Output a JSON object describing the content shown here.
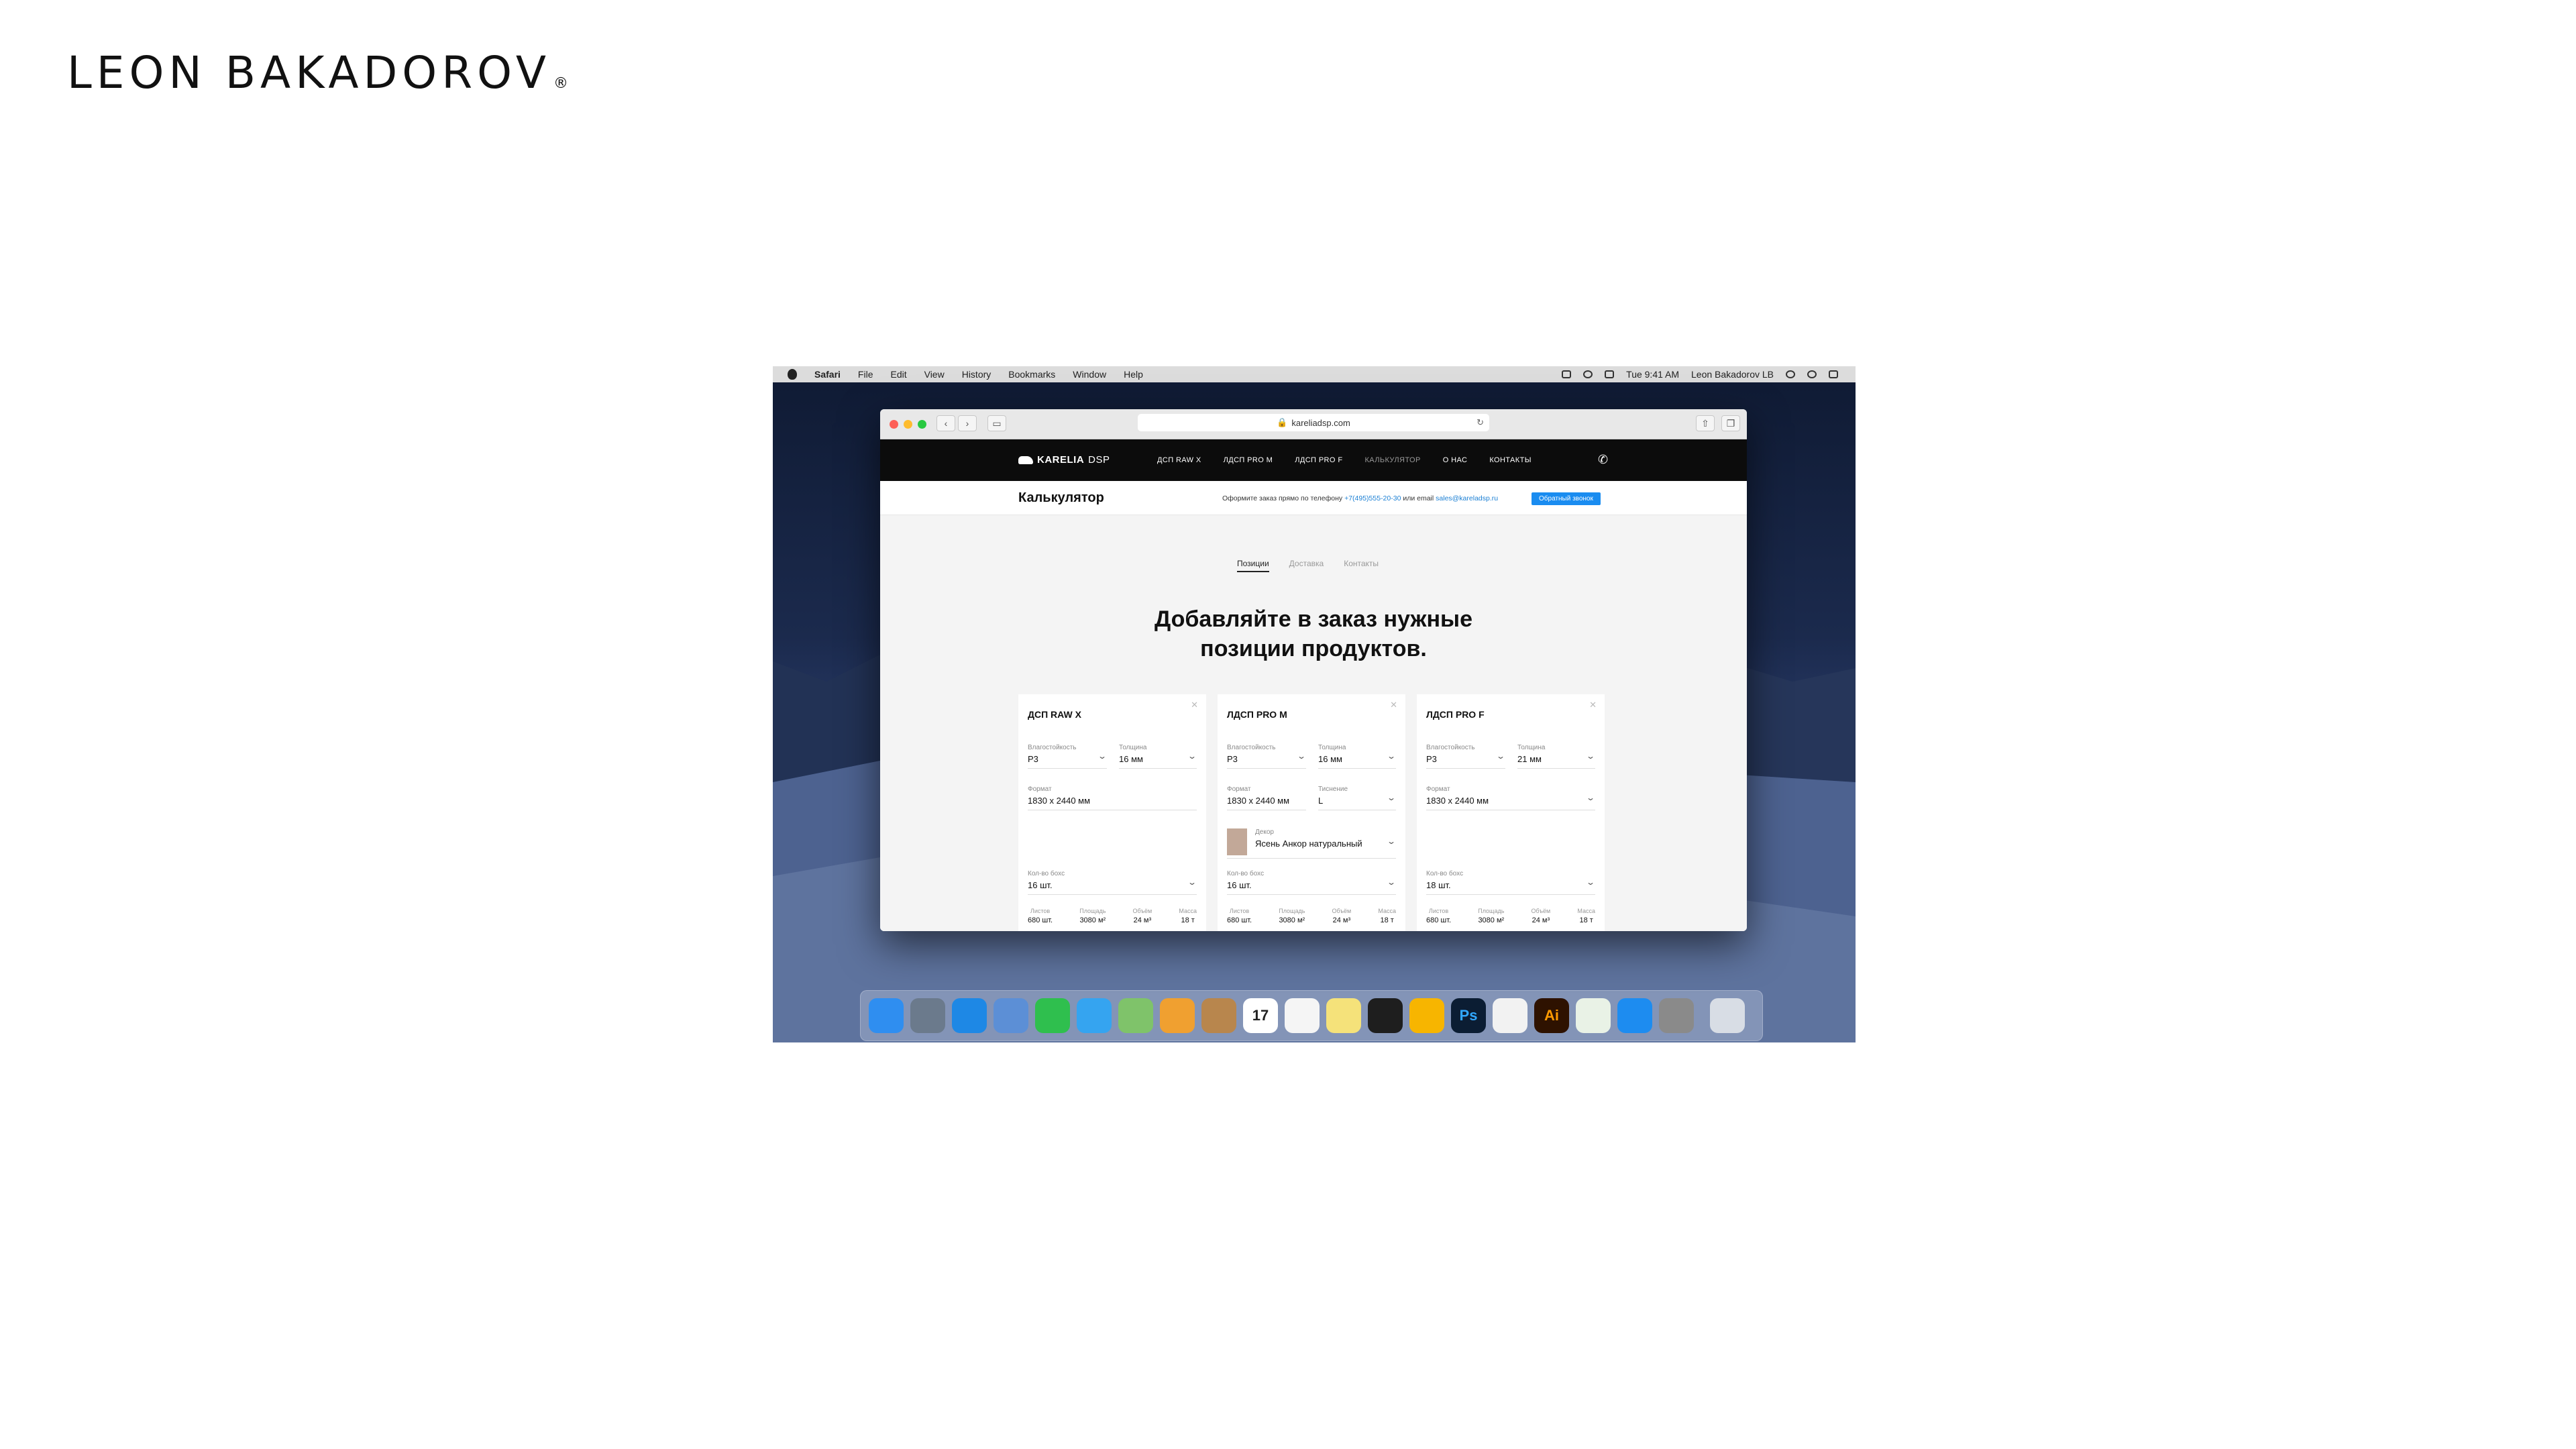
{
  "brand": {
    "name": "LEON BAKADOROV",
    "mark": "®"
  },
  "menubar": {
    "items": [
      "Safari",
      "File",
      "Edit",
      "View",
      "History",
      "Bookmarks",
      "Window",
      "Help"
    ],
    "time": "Tue 9:41 AM",
    "user": "Leon Bakadorov LB"
  },
  "browser": {
    "url": "kareliadsp.com"
  },
  "site": {
    "logo": "KARELIA",
    "logo_sub": "DSP",
    "nav": [
      "ДСП RAW X",
      "ЛДСП PRO M",
      "ЛДСП PRO F",
      "КАЛЬКУЛЯТОР",
      "О НАС",
      "КОНТАКТЫ"
    ],
    "page_title": "Калькулятор",
    "contact_prefix": "Оформите заказ прямо по телефону",
    "phone": "+7(495)555-20-30",
    "contact_mid": "или email",
    "email": "sales@kareladsp.ru",
    "callback_button": "Обратный звонок",
    "tabs": [
      "Позиции",
      "Доставка",
      "Контакты"
    ],
    "hero_line1": "Добавляйте в заказ нужные",
    "hero_line2": "позиции продуктов."
  },
  "cards": [
    {
      "name": "ДСП RAW X",
      "moisture_label": "Влагостойкость",
      "moisture": "P3",
      "thickness_label": "Толщина",
      "thickness": "16 мм",
      "format_label": "Формат",
      "format": "1830 x 2440 мм",
      "qty_label": "Кол-во боxc",
      "qty": "16 шт.",
      "stats": [
        {
          "label": "Листов",
          "value": "680 шт."
        },
        {
          "label": "Площадь",
          "value": "3080 м²"
        },
        {
          "label": "Объём",
          "value": "24 м³"
        },
        {
          "label": "Масса",
          "value": "18 т"
        }
      ]
    },
    {
      "name": "ЛДСП PRO M",
      "moisture_label": "Влагостойкость",
      "moisture": "P3",
      "thickness_label": "Толщина",
      "thickness": "16 мм",
      "format_label": "Формат",
      "format": "1830 x 2440 мм",
      "texture_label": "Тиснение",
      "texture": "L",
      "decor_label": "Декор",
      "decor": "Ясень Анкор натуральный",
      "qty_label": "Кол-во боxc",
      "qty": "16 шт.",
      "stats": [
        {
          "label": "Листов",
          "value": "680 шт."
        },
        {
          "label": "Площадь",
          "value": "3080 м²"
        },
        {
          "label": "Объём",
          "value": "24 м³"
        },
        {
          "label": "Масса",
          "value": "18 т"
        }
      ]
    },
    {
      "name": "ЛДСП PRO F",
      "moisture_label": "Влагостойкость",
      "moisture": "P3",
      "thickness_label": "Толщина",
      "thickness": "21 мм",
      "format_label": "Формат",
      "format": "1830 x 2440 мм",
      "qty_label": "Кол-во боxc",
      "qty": "18 шт.",
      "stats": [
        {
          "label": "Листов",
          "value": "680 шт."
        },
        {
          "label": "Площадь",
          "value": "3080 м²"
        },
        {
          "label": "Объём",
          "value": "24 м³"
        },
        {
          "label": "Масса",
          "value": "18 т"
        }
      ]
    }
  ],
  "dock": {
    "apps": [
      {
        "icon": "finder-icon",
        "color": "#2f8ef0"
      },
      {
        "icon": "launchpad-icon",
        "color": "#6b7a8c"
      },
      {
        "icon": "safari-icon",
        "color": "#1e88e5"
      },
      {
        "icon": "preview-icon",
        "color": "#5c8fd6"
      },
      {
        "icon": "facetime-icon",
        "color": "#2fbf4e"
      },
      {
        "icon": "messages-icon",
        "color": "#35a4f0"
      },
      {
        "icon": "maps-icon",
        "color": "#7fc36a"
      },
      {
        "icon": "photos-icon",
        "color": "#f0a030"
      },
      {
        "icon": "contacts-icon",
        "color": "#b8864d"
      },
      {
        "icon": "calendar-icon",
        "color": "#ffffff"
      },
      {
        "icon": "reminders-icon",
        "color": "#f5f5f5"
      },
      {
        "icon": "notes-icon",
        "color": "#f5e27a"
      },
      {
        "icon": "figma-icon",
        "color": "#1e1e1e"
      },
      {
        "icon": "sketch-icon",
        "color": "#f7b500"
      },
      {
        "icon": "photoshop-icon",
        "color": "#0b1d33"
      },
      {
        "icon": "itunes-icon",
        "color": "#f2f2f2"
      },
      {
        "icon": "illustrator-icon",
        "color": "#2e1200"
      },
      {
        "icon": "numbers-icon",
        "color": "#e9f2e6"
      },
      {
        "icon": "appstore-icon",
        "color": "#1d8cf0"
      },
      {
        "icon": "system-preferences-icon",
        "color": "#8a8a8a"
      },
      {
        "icon": "trash-icon",
        "color": "#d8dde5"
      }
    ],
    "calendar_day": "17",
    "ps_label": "Ps",
    "ai_label": "Ai"
  }
}
